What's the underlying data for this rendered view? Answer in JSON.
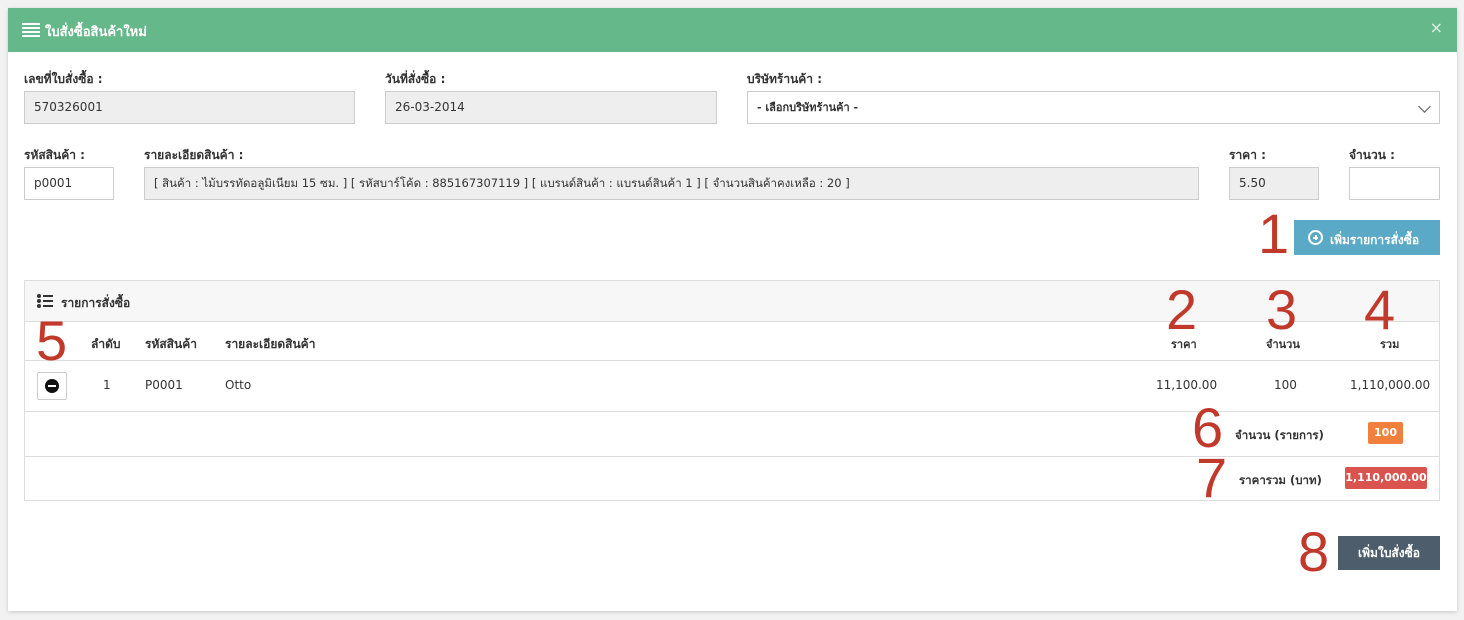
{
  "modal": {
    "title": "ใบสั่งซื้อสินค้าใหม่",
    "close": "×"
  },
  "form": {
    "po_number_label": "เลขที่ใบสั่งซื้อ :",
    "po_number_value": "570326001",
    "order_date_label": "วันที่สั่งซื้อ :",
    "order_date_value": "26-03-2014",
    "supplier_label": "บริษัทร้านค้า :",
    "supplier_value": "- เลือกบริษัทร้านค้า -",
    "product_code_label": "รหัสสินค้า :",
    "product_code_value": "p0001",
    "product_detail_label": "รายละเอียดสินค้า :",
    "product_detail_value": "[ สินค้า : ไม้บรรทัดอลูมิเนียม 15 ซม. ] [ รหัสบาร์โค้ด : 885167307119 ] [ แบรนด์สินค้า : แบรนด์สินค้า 1 ] [ จำนวนสินค้าคงเหลือ : 20 ]",
    "price_label": "ราคา :",
    "price_value": "5.50",
    "qty_label": "จำนวน :",
    "qty_value": ""
  },
  "add_item_button": "เพิ่มรายการสั่งซื้อ",
  "order_list": {
    "title": "รายการสั่งซื้อ",
    "columns": {
      "no": "ลำดับ",
      "code": "รหัสสินค้า",
      "detail": "รายละเอียดสินค้า",
      "price": "ราคา",
      "qty": "จำนวน",
      "total": "รวม"
    },
    "rows": [
      {
        "no": "1",
        "code": "P0001",
        "detail": "Otto",
        "price": "11,100.00",
        "qty": "100",
        "total": "1,110,000.00"
      }
    ],
    "summary_qty_label": "จำนวน (รายการ)",
    "summary_qty_value": "100",
    "summary_total_label": "ราคารวม (บาท)",
    "summary_total_value": "1,110,000.00"
  },
  "submit_button": "เพิ่มใบสั่งซื้อ",
  "annotations": [
    "1",
    "2",
    "3",
    "4",
    "5",
    "6",
    "7",
    "8"
  ],
  "colors": {
    "header": "#65b889",
    "info_button": "#5aa9c6",
    "dark_button": "#4d5d6b",
    "badge_orange": "#f0803c",
    "badge_red": "#d9534f",
    "annotation": "#c0392b"
  }
}
